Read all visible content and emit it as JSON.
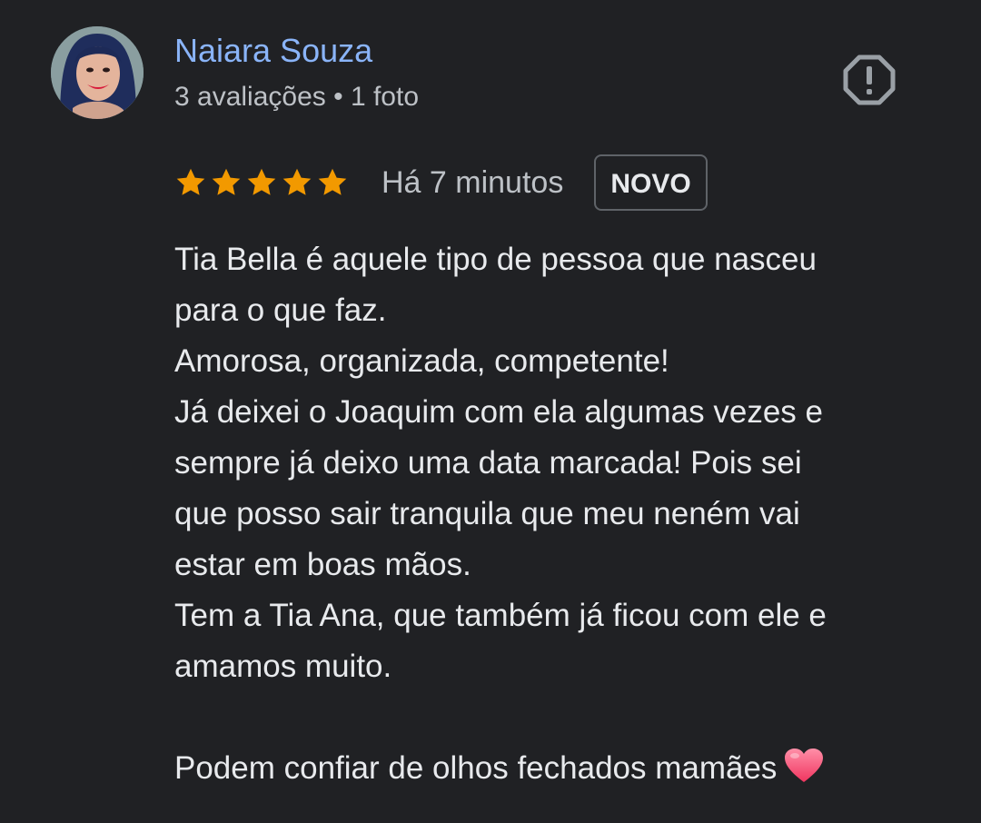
{
  "reviewer": {
    "name": "Naiara Souza",
    "meta": "3 avaliações • 1 foto"
  },
  "icons": {
    "avatar": "avatar-photo",
    "report": "report-flag-icon",
    "star": "star-icon",
    "heart": "heart-emoji-icon"
  },
  "rating": {
    "stars": 5,
    "max_stars": 5,
    "time_ago": "Há 7 minutos",
    "badge": "NOVO"
  },
  "review": {
    "lines": [
      "Tia Bella é aquele tipo de pessoa que nasceu",
      "para o que faz.",
      "Amorosa, organizada, competente!",
      "Já deixei o Joaquim com ela algumas vezes e",
      "sempre já deixo uma data marcada! Pois sei",
      "que posso sair tranquila que meu neném vai",
      "estar em boas mãos.",
      "Tem a Tia Ana, que também já ficou com ele e",
      "amamos muito.",
      "",
      "Podem confiar de olhos fechados mamães"
    ]
  },
  "colors": {
    "background": "#202124",
    "name": "#8ab4f8",
    "text": "#e8eaed",
    "secondary_text": "#bdc1c6",
    "star": "#f29900",
    "badge_border": "#5f6368",
    "heart": "#ff4f7b"
  }
}
